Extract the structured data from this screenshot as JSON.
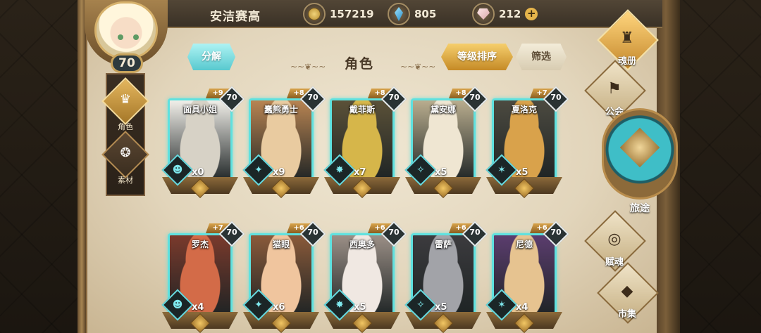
{
  "player": {
    "name": "安洁赛高",
    "level": "70"
  },
  "currencies": {
    "gold": "157219",
    "crystal": "805",
    "gem": "212"
  },
  "side_tabs": [
    {
      "label": "角色",
      "icon": "hero-helmet-icon",
      "active": true
    },
    {
      "label": "素材",
      "icon": "material-icon",
      "active": false
    }
  ],
  "header": {
    "decompose": "分解",
    "title": "角色",
    "sort": "等级排序",
    "filter": "筛选"
  },
  "heroes": [
    {
      "name": "面具小姐",
      "plus": "+9",
      "level": "70",
      "count": "x0",
      "portrait": "#f1efe9",
      "accent": "#d7d2c6"
    },
    {
      "name": "蠢熊勇士",
      "plus": "+8",
      "level": "70",
      "count": "x9",
      "portrait": "#b88452",
      "accent": "#e9cba0"
    },
    {
      "name": "戴菲斯",
      "plus": "+8",
      "level": "70",
      "count": "x7",
      "portrait": "#5b5138",
      "accent": "#d6b64a"
    },
    {
      "name": "黛安娜",
      "plus": "+8",
      "level": "70",
      "count": "x5",
      "portrait": "#b9ad8e",
      "accent": "#efe6d2"
    },
    {
      "name": "夏洛克",
      "plus": "+7",
      "level": "70",
      "count": "x5",
      "portrait": "#4c4a40",
      "accent": "#d9a24b"
    },
    {
      "name": "罗杰",
      "plus": "+7",
      "level": "70",
      "count": "x4",
      "portrait": "#7a3a2c",
      "accent": "#d36b48"
    },
    {
      "name": "猫眼",
      "plus": "+6",
      "level": "70",
      "count": "x6",
      "portrait": "#8a5a3a",
      "accent": "#f0c59e"
    },
    {
      "name": "西奥多",
      "plus": "+6",
      "level": "70",
      "count": "x5",
      "portrait": "#9b8f86",
      "accent": "#f0e8e2"
    },
    {
      "name": "雷萨",
      "plus": "+6",
      "level": "70",
      "count": "x5",
      "portrait": "#3c3b3e",
      "accent": "#a2a3a8"
    },
    {
      "name": "尼德",
      "plus": "+6",
      "level": "70",
      "count": "x4",
      "portrait": "#5b3d6e",
      "accent": "#e6c390"
    }
  ],
  "right_menu": [
    {
      "label": "魂册",
      "icon": "soul-book-icon",
      "active": true
    },
    {
      "label": "公会",
      "icon": "guild-icon",
      "active": false
    },
    {
      "label": "旅途",
      "icon": "journey-icon",
      "active": false
    },
    {
      "label": "赋魂",
      "icon": "soul-infuse-icon",
      "active": false
    },
    {
      "label": "市集",
      "icon": "market-icon",
      "active": false
    }
  ]
}
